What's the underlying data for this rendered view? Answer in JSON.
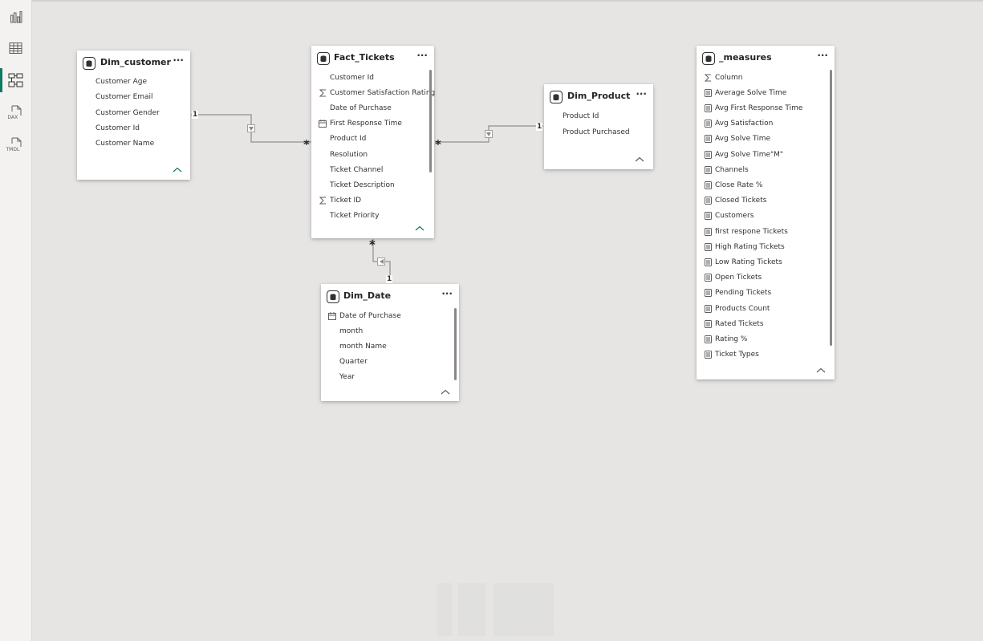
{
  "sidebar": {
    "items": [
      {
        "name": "report-view",
        "icon": "bar-chart-icon",
        "label": ""
      },
      {
        "name": "table-view",
        "icon": "table-grid-icon",
        "label": ""
      },
      {
        "name": "model-view",
        "icon": "model-diagram-icon",
        "label": "",
        "active": true
      },
      {
        "name": "dax-query-view",
        "icon": "dax-file-icon",
        "label": "DAX"
      },
      {
        "name": "tmdl-view",
        "icon": "tmdl-file-icon",
        "label": "TMDL"
      }
    ]
  },
  "tables": {
    "dim_customer": {
      "title": "Dim_customer",
      "fields": [
        "Customer Age",
        "Customer Email",
        "Customer Gender",
        "Customer Id",
        "Customer Name"
      ]
    },
    "fact_tickets": {
      "title": "Fact_Tickets",
      "fields": [
        {
          "label": "Customer Id",
          "icon": ""
        },
        {
          "label": "Customer Satisfaction Rating",
          "icon": "sigma-icon"
        },
        {
          "label": "Date of Purchase",
          "icon": ""
        },
        {
          "label": "First Response Time",
          "icon": "calendar-icon"
        },
        {
          "label": "Product Id",
          "icon": ""
        },
        {
          "label": "Resolution",
          "icon": ""
        },
        {
          "label": "Ticket Channel",
          "icon": ""
        },
        {
          "label": "Ticket Description",
          "icon": ""
        },
        {
          "label": "Ticket ID",
          "icon": "sigma-icon"
        },
        {
          "label": "Ticket Priority",
          "icon": ""
        }
      ]
    },
    "dim_product": {
      "title": "Dim_Product",
      "fields": [
        "Product Id",
        "Product Purchased"
      ]
    },
    "dim_date": {
      "title": "Dim_Date",
      "fields": [
        {
          "label": "Date of Purchase",
          "icon": "calendar-icon"
        },
        {
          "label": "month",
          "icon": ""
        },
        {
          "label": "month Name",
          "icon": ""
        },
        {
          "label": "Quarter",
          "icon": ""
        },
        {
          "label": "Year",
          "icon": ""
        }
      ]
    },
    "measures": {
      "title": "_measures",
      "fields": [
        {
          "label": "Column",
          "icon": "sigma-icon"
        },
        {
          "label": "Average Solve Time",
          "icon": "calculator-icon"
        },
        {
          "label": "Avg First Response Time",
          "icon": "calculator-icon"
        },
        {
          "label": "Avg Satisfaction",
          "icon": "calculator-icon"
        },
        {
          "label": "Avg Solve Time",
          "icon": "calculator-icon"
        },
        {
          "label": "Avg Solve Time\"M\"",
          "icon": "calculator-icon"
        },
        {
          "label": "Channels",
          "icon": "calculator-icon"
        },
        {
          "label": "Close Rate %",
          "icon": "calculator-icon"
        },
        {
          "label": "Closed Tickets",
          "icon": "calculator-icon"
        },
        {
          "label": "Customers",
          "icon": "calculator-icon"
        },
        {
          "label": "first respone Tickets",
          "icon": "calculator-icon"
        },
        {
          "label": "High Rating Tickets",
          "icon": "calculator-icon"
        },
        {
          "label": "Low Rating Tickets",
          "icon": "calculator-icon"
        },
        {
          "label": "Open Tickets",
          "icon": "calculator-icon"
        },
        {
          "label": "Pending Tickets",
          "icon": "calculator-icon"
        },
        {
          "label": "Products Count",
          "icon": "calculator-icon"
        },
        {
          "label": "Rated Tickets",
          "icon": "calculator-icon"
        },
        {
          "label": "Rating %",
          "icon": "calculator-icon"
        },
        {
          "label": "Ticket Types",
          "icon": "calculator-icon"
        }
      ]
    }
  },
  "relationships": [
    {
      "from": "Dim_customer",
      "to": "Fact_Tickets",
      "one_label": "1",
      "many_label": "*"
    },
    {
      "from": "Dim_Product",
      "to": "Fact_Tickets",
      "one_label": "1",
      "many_label": "*"
    },
    {
      "from": "Dim_Date",
      "to": "Fact_Tickets",
      "one_label": "1",
      "many_label": "*"
    }
  ],
  "card_menu_label": "···",
  "colors": {
    "canvas": "#e6e5e4",
    "accent": "#117865",
    "card": "#ffffff",
    "line": "#a19f9d"
  }
}
